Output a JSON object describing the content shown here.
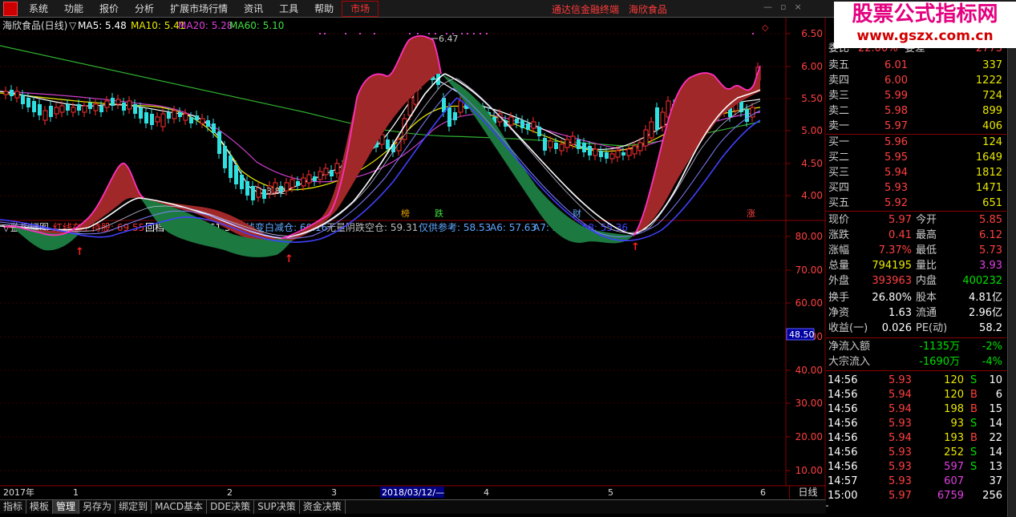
{
  "menu": [
    "系统",
    "功能",
    "报价",
    "分析",
    "扩展市场行情",
    "资讯",
    "工具",
    "帮助",
    "市场"
  ],
  "terminal": {
    "name": "通达信金融终端",
    "stock": "海欣食品"
  },
  "watermark": {
    "line1": "股票公式指标网",
    "line2": "www.gszx.com.cn"
  },
  "upper_header": {
    "title": "海欣食品(日线)",
    "ma5": "MA5: 5.48",
    "ma10": "MA10: 5.41",
    "ma20": "MA20: 5.28",
    "ma60": "MA60: 5.10"
  },
  "upper_yaxis": [
    "6.50",
    "6.00",
    "5.50",
    "5.00",
    "4.50",
    "4.00"
  ],
  "annotations": {
    "high": "6.47",
    "low": "3.82"
  },
  "event_markers": [
    "榜",
    "跌",
    "财",
    "涨"
  ],
  "lower_header": {
    "name": "监控幅图",
    "items": [
      {
        "text": "红线在上持股: 69.55",
        "color": "#ff3030"
      },
      {
        "text": "回档不破洗盘: 61.38",
        "color": "#ffffff"
      },
      {
        "text": "红线变白减仓: 60.16",
        "color": "#5fa8ff"
      },
      {
        "text": "无量阴跌空仓: 59.31",
        "color": "#bbbbbb"
      },
      {
        "text": "仅供参考: 58.53",
        "color": "#5fa8ff"
      },
      {
        "text": "A6: 57.63",
        "color": "#5fa8ff"
      },
      {
        "text": "A7: 56.51",
        "color": "#5fa8ff"
      },
      {
        "text": "A8: 55.36",
        "color": "#4040ff"
      }
    ]
  },
  "lower_yaxis": [
    "80.00",
    "70.00",
    "60.00",
    "50.00",
    "40.00",
    "30.00",
    "20.00",
    "10.00"
  ],
  "crosshair_value": "48.50",
  "time_axis": [
    "2017年",
    "1",
    "2",
    "3",
    "2018/03/12/—",
    "4",
    "5",
    "6"
  ],
  "daily_label": "日线",
  "bottom_tabs": [
    "指标",
    "模板",
    "管理",
    "另存为",
    "绑定到",
    "MACD基本",
    "DDE决策",
    "SUP决策",
    "资金决策"
  ],
  "active_tab": "管理",
  "order_book": {
    "ratio_label": "委比",
    "ratio_value": "22.00%",
    "diff_label": "委差",
    "diff_value": "2773",
    "asks": [
      {
        "label": "卖五",
        "price": "6.01",
        "vol": "337"
      },
      {
        "label": "卖四",
        "price": "6.00",
        "vol": "1222"
      },
      {
        "label": "卖三",
        "price": "5.99",
        "vol": "724"
      },
      {
        "label": "卖二",
        "price": "5.98",
        "vol": "899"
      },
      {
        "label": "卖一",
        "price": "5.97",
        "vol": "406"
      }
    ],
    "bids": [
      {
        "label": "买一",
        "price": "5.96",
        "vol": "124"
      },
      {
        "label": "买二",
        "price": "5.95",
        "vol": "1649"
      },
      {
        "label": "买三",
        "price": "5.94",
        "vol": "1812"
      },
      {
        "label": "买四",
        "price": "5.93",
        "vol": "1471"
      },
      {
        "label": "买五",
        "price": "5.92",
        "vol": "651"
      }
    ]
  },
  "stats": [
    {
      "l1": "现价",
      "v1": "5.97",
      "c1": "red",
      "l2": "今开",
      "v2": "5.85",
      "c2": "red"
    },
    {
      "l1": "涨跌",
      "v1": "0.41",
      "c1": "red",
      "l2": "最高",
      "v2": "6.12",
      "c2": "red"
    },
    {
      "l1": "涨幅",
      "v1": "7.37%",
      "c1": "red",
      "l2": "最低",
      "v2": "5.73",
      "c2": "red"
    },
    {
      "l1": "总量",
      "v1": "794195",
      "c1": "yellow",
      "l2": "量比",
      "v2": "3.93",
      "c2": "magenta"
    },
    {
      "l1": "外盘",
      "v1": "393963",
      "c1": "red",
      "l2": "内盘",
      "v2": "400232",
      "c2": "green"
    },
    {
      "l1": "换手",
      "v1": "26.80%",
      "c1": "white",
      "l2": "股本",
      "v2": "4.81亿",
      "c2": "white"
    },
    {
      "l1": "净资",
      "v1": "1.63",
      "c1": "white",
      "l2": "流通",
      "v2": "2.96亿",
      "c2": "white"
    },
    {
      "l1": "收益(一)",
      "v1": "0.026",
      "c1": "white",
      "l2": "PE(动)",
      "v2": "58.2",
      "c2": "white"
    }
  ],
  "flows": [
    {
      "label": "净流入额",
      "value": "-1135万",
      "pct": "-2%"
    },
    {
      "label": "大宗流入",
      "value": "-1690万",
      "pct": "-4%"
    }
  ],
  "ticks": [
    {
      "time": "14:56",
      "price": "5.93",
      "vol": "120",
      "side": "S",
      "n": "10"
    },
    {
      "time": "14:56",
      "price": "5.94",
      "vol": "120",
      "side": "B",
      "n": "6"
    },
    {
      "time": "14:56",
      "price": "5.94",
      "vol": "198",
      "side": "B",
      "n": "15"
    },
    {
      "time": "14:56",
      "price": "5.93",
      "vol": "93",
      "side": "S",
      "n": "14"
    },
    {
      "time": "14:56",
      "price": "5.94",
      "vol": "193",
      "side": "B",
      "n": "22"
    },
    {
      "time": "14:56",
      "price": "5.93",
      "vol": "252",
      "side": "S",
      "n": "14"
    },
    {
      "time": "14:56",
      "price": "5.93",
      "vol": "597",
      "side": "S",
      "n": "13"
    },
    {
      "time": "14:57",
      "price": "5.93",
      "vol": "607",
      "side": "",
      "n": "37"
    },
    {
      "time": "15:00",
      "price": "5.97",
      "vol": "6759",
      "side": "",
      "n": "256"
    }
  ],
  "toolbar_signs": {
    "plus": "+",
    "minus": "−"
  }
}
